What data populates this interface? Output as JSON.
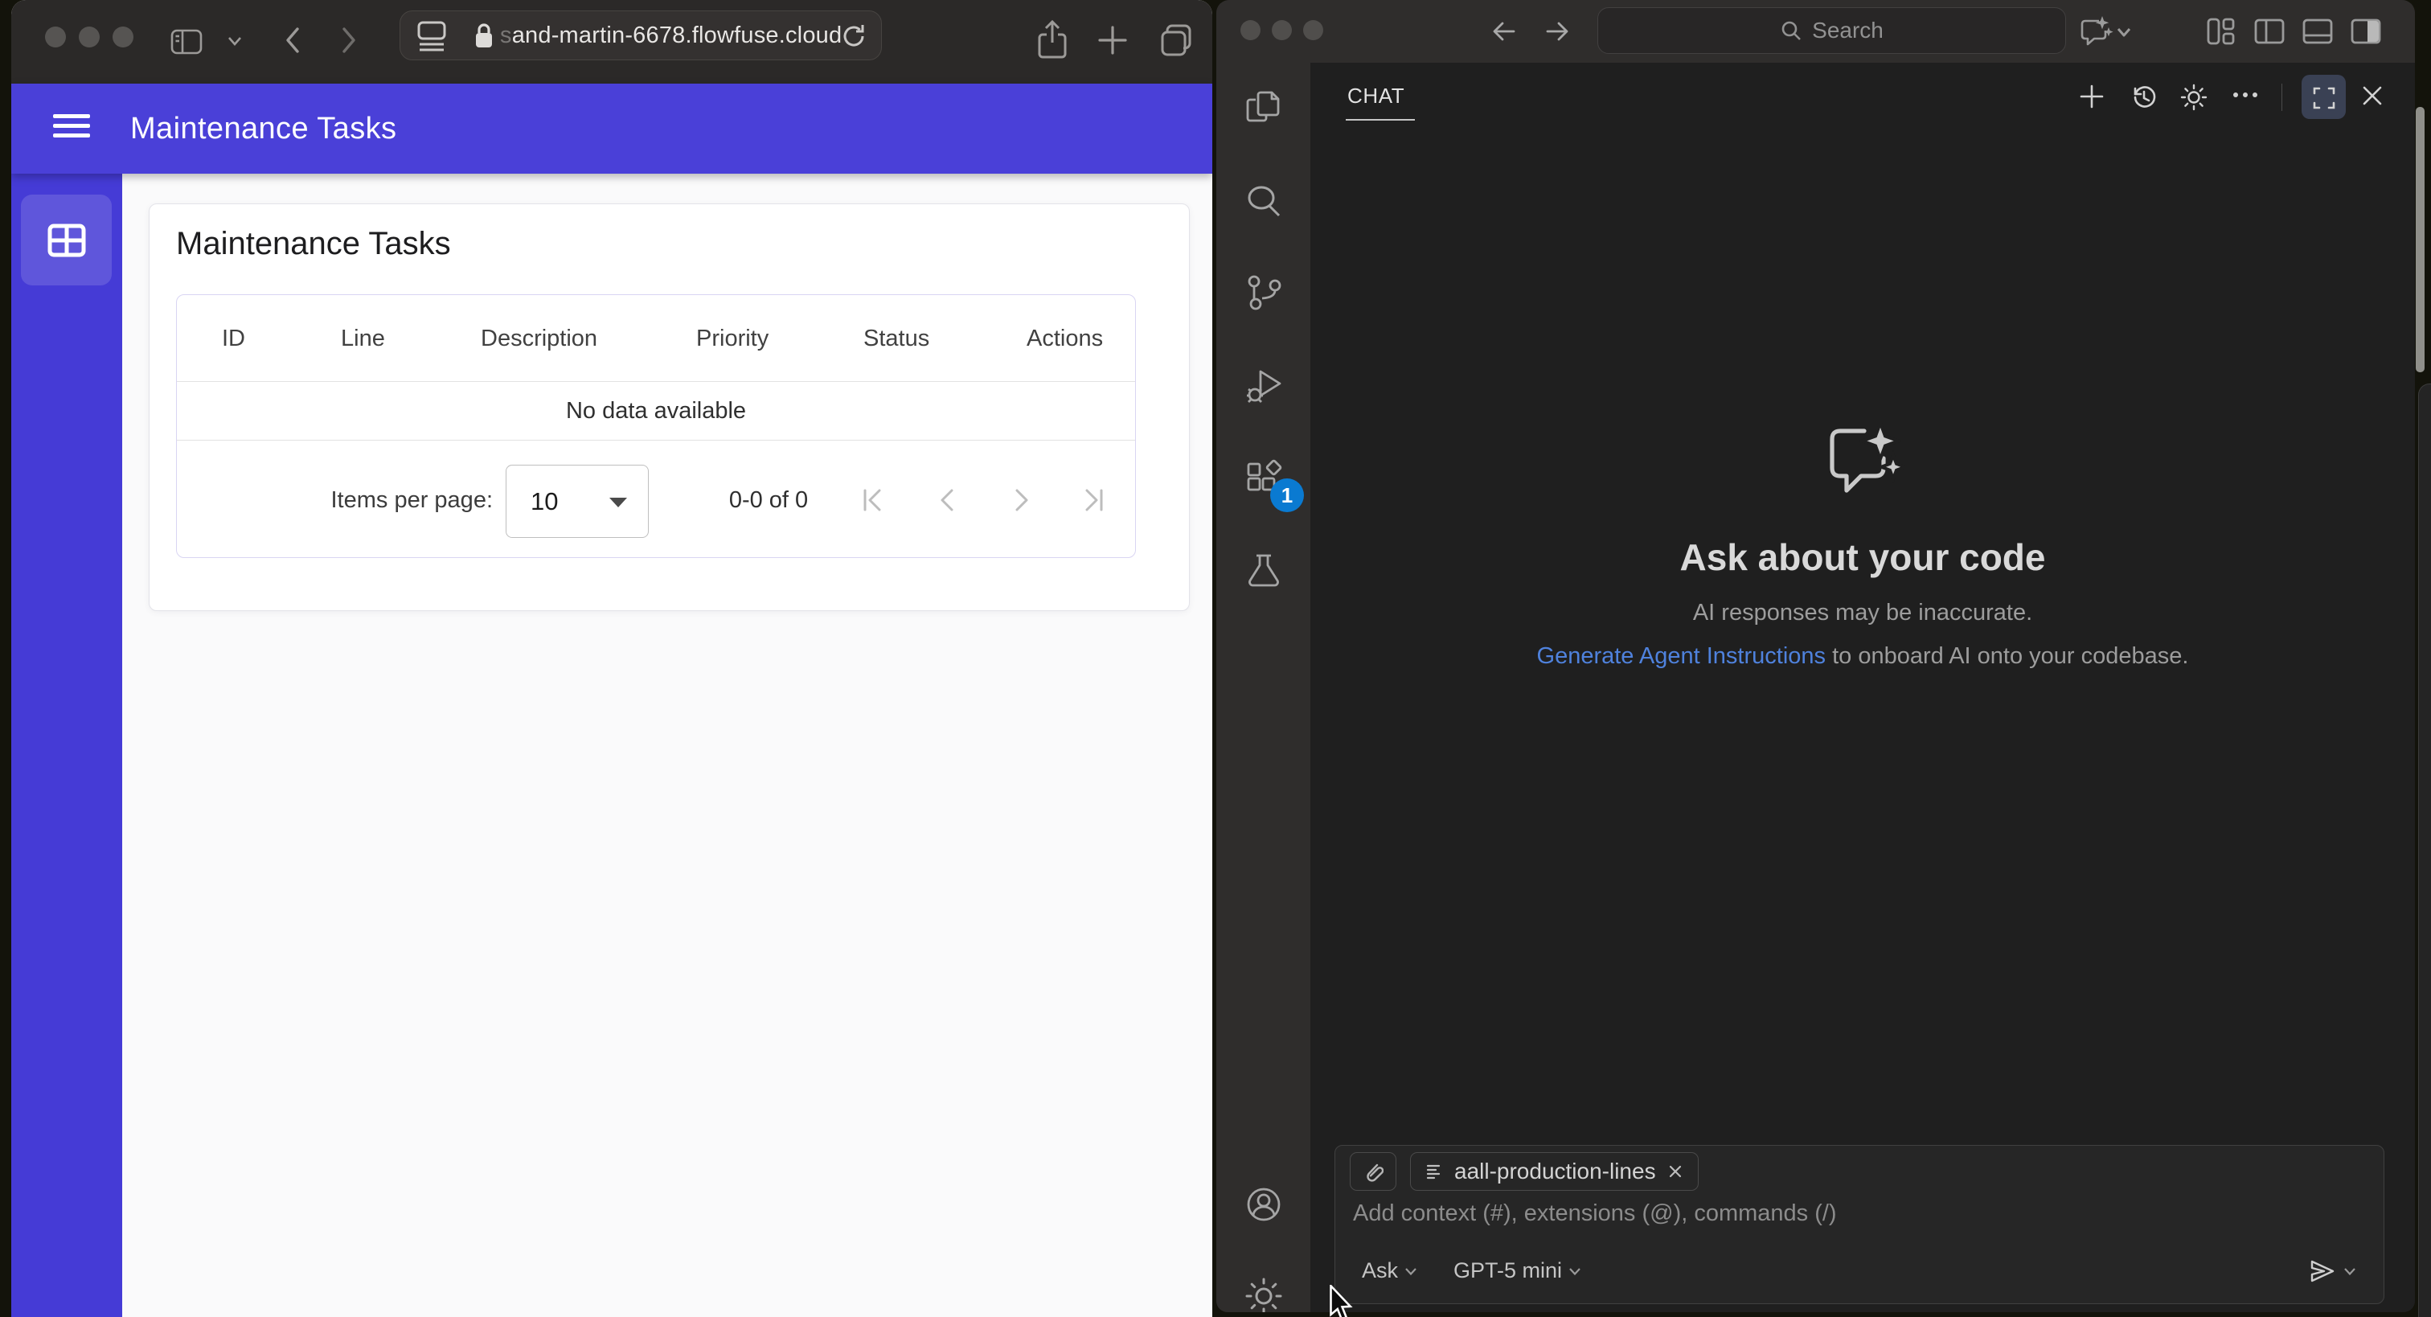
{
  "browser": {
    "url": "sand-martin-6678.flowfuse.cloud",
    "app": {
      "title": "Maintenance Tasks",
      "card_title": "Maintenance Tasks",
      "table": {
        "columns": [
          "ID",
          "Line",
          "Description",
          "Priority",
          "Status",
          "Actions"
        ],
        "empty_message": "No data available",
        "items_per_page_label": "Items per page:",
        "items_per_page_value": "10",
        "range_label": "0-0 of 0"
      }
    }
  },
  "editor": {
    "titlebar": {
      "search_placeholder": "Search"
    },
    "activity_bar": {
      "extensions_badge": "1"
    },
    "chat": {
      "tab_label": "CHAT",
      "empty": {
        "title": "Ask about your code",
        "subtitle": "AI responses may be inaccurate.",
        "link_text": "Generate Agent Instructions",
        "link_suffix": " to onboard AI onto your codebase."
      },
      "input": {
        "attachment": "aall-production-lines",
        "placeholder": "Add context (#), extensions (@), commands (/)",
        "mode": "Ask",
        "model": "GPT-5 mini"
      }
    }
  },
  "colors": {
    "app_primary_purple": "#4a40d8",
    "link_blue": "#4f82dd",
    "badge_blue": "#0a7ad1",
    "chat_background": "#1f1f1f",
    "titlebar_gray": "#2f2d2c"
  }
}
